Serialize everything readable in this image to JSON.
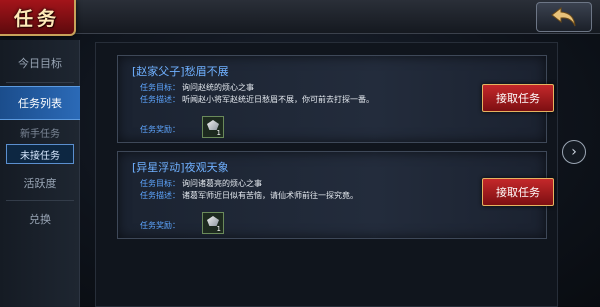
{
  "header": {
    "title": "任务"
  },
  "sidebar": {
    "items": [
      {
        "label": "今日目标"
      },
      {
        "label": "任务列表"
      },
      {
        "label": "新手任务"
      },
      {
        "label": "未接任务"
      },
      {
        "label": "活跃度"
      },
      {
        "label": "兑换"
      }
    ]
  },
  "quests": [
    {
      "title": "[赵家父子]愁眉不展",
      "goal_key": "任务目标：",
      "goal": "询问赵统的烦心之事",
      "desc_key": "任务描述：",
      "desc": "听闻赵小将军赵统近日愁眉不展，你可前去打探一番。",
      "reward_key": "任务奖励：",
      "reward_count": "1",
      "accept_label": "接取任务"
    },
    {
      "title": "[异星浮动]夜观天象",
      "goal_key": "任务目标：",
      "goal": "询问诸葛亮的烦心之事",
      "desc_key": "任务描述：",
      "desc": "诸葛军师近日似有苦恼，请仙术师前往一探究竟。",
      "reward_key": "任务奖励：",
      "reward_count": "1",
      "accept_label": "接取任务"
    }
  ],
  "colors": {
    "accent_red": "#c4282a",
    "accent_blue": "#2b6ab7",
    "title_blue": "#6fb0ff"
  },
  "icons": {
    "back": "back-arrow-icon",
    "next": "chevron-right-icon",
    "reward": "gem-icon"
  }
}
